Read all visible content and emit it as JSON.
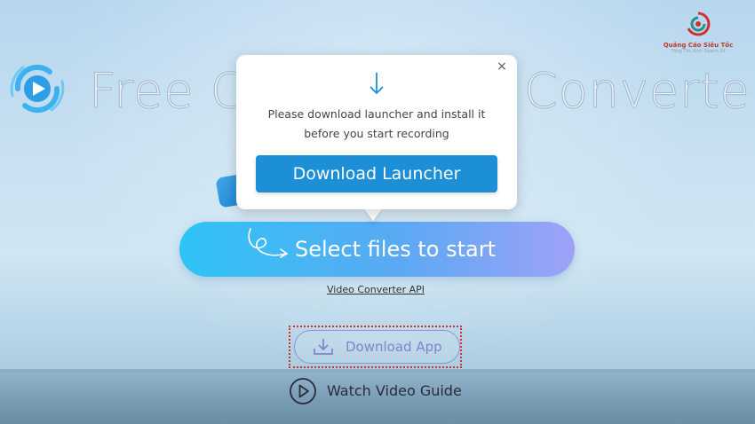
{
  "hero": {
    "title_left": "Free C",
    "title_right": "Converter"
  },
  "brand": {
    "name": "Quảng Cáo Siêu Tốc",
    "tagline": "Tăng Tốc Kinh Doanh Số"
  },
  "popup": {
    "message_line1": "Please download launcher and install it",
    "message_line2": "before you start recording",
    "button_label": "Download Launcher",
    "close_symbol": "×"
  },
  "main": {
    "select_label": "Select files to start",
    "api_link": "Video Converter API",
    "download_app_label": "Download App",
    "watch_guide_label": "Watch Video Guide"
  },
  "colors": {
    "accent_blue": "#1d8fd6",
    "cta_gradient_start": "#2ec4f5",
    "cta_gradient_end": "#9ea2f7",
    "download_app_outline": "#8b94d6",
    "highlight_frame": "#d0312d"
  },
  "icons": {
    "app_logo": "play-circle-logo",
    "popup_arrow": "arrow-down-icon",
    "download_app": "download-tray-icon",
    "watch_guide": "play-circle-icon",
    "close": "close-icon"
  }
}
